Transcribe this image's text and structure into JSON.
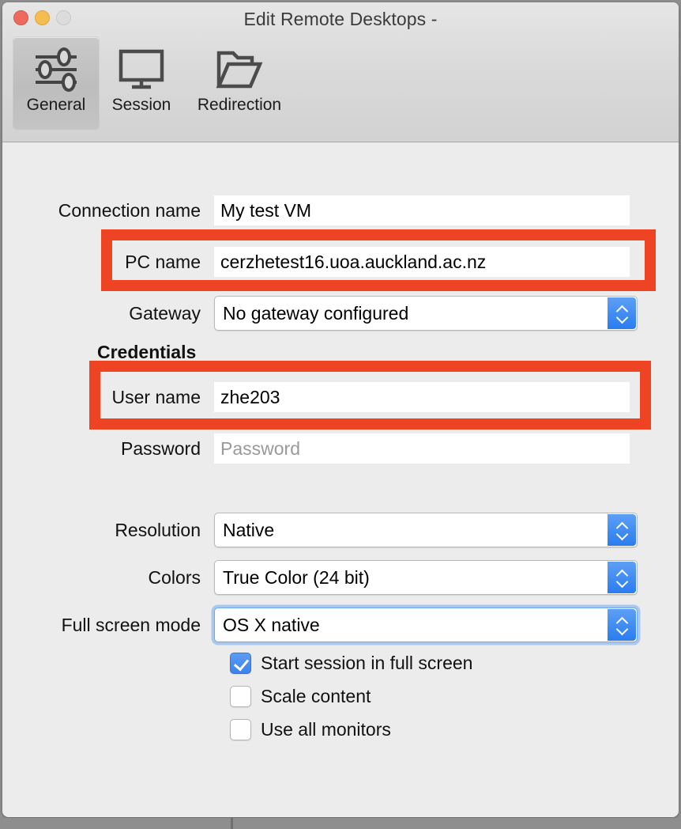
{
  "window": {
    "title": "Edit Remote Desktops -",
    "traffic_lights": [
      {
        "name": "close",
        "color": "#ee6a5f"
      },
      {
        "name": "minimize",
        "color": "#f5bd4f"
      },
      {
        "name": "zoom",
        "color": "#dcdcdc"
      }
    ]
  },
  "toolbar": {
    "items": [
      {
        "label": "General",
        "icon": "sliders-icon",
        "selected": true
      },
      {
        "label": "Session",
        "icon": "monitor-icon",
        "selected": false
      },
      {
        "label": "Redirection",
        "icon": "open-folder-icon",
        "selected": false
      }
    ]
  },
  "form": {
    "connection_name": {
      "label": "Connection name",
      "value": "My test VM"
    },
    "pc_name": {
      "label": "PC name",
      "value": "cerzhetest16.uoa.auckland.ac.nz"
    },
    "gateway": {
      "label": "Gateway",
      "value": "No gateway configured"
    },
    "credentials_heading": "Credentials",
    "user_name": {
      "label": "User name",
      "value": "zhe203"
    },
    "password": {
      "label": "Password",
      "placeholder": "Password",
      "value": ""
    },
    "resolution": {
      "label": "Resolution",
      "value": "Native"
    },
    "colors": {
      "label": "Colors",
      "value": "True Color (24 bit)"
    },
    "full_screen_mode": {
      "label": "Full screen mode",
      "value": "OS X native",
      "focused": true
    },
    "checkboxes": [
      {
        "label": "Start session in full screen",
        "checked": true
      },
      {
        "label": "Scale content",
        "checked": false
      },
      {
        "label": "Use all monitors",
        "checked": false
      }
    ]
  },
  "annotations": {
    "accent_color": "#ef4423",
    "boxes": [
      {
        "target": "pc-name-row"
      },
      {
        "target": "user-name-row"
      }
    ]
  }
}
